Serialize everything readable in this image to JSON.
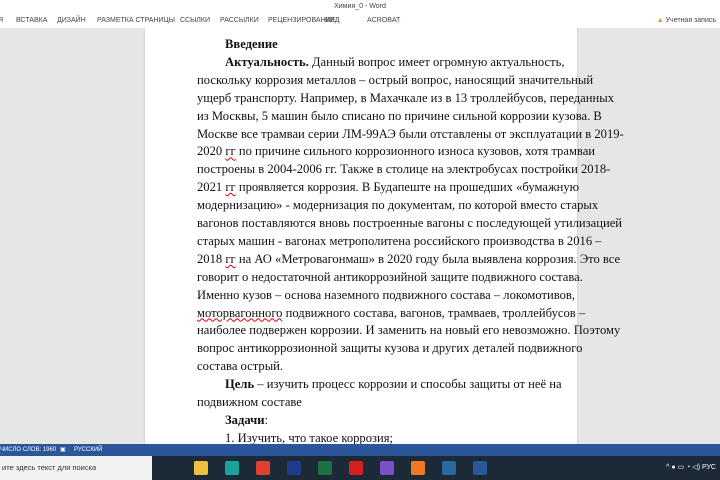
{
  "window": {
    "title": "Химия_0 - Word",
    "account": "Учетная запись"
  },
  "ribbon": {
    "tabs": [
      "Я",
      "ВСТАВКА",
      "ДИЗАЙН",
      "РАЗМЕТКА СТРАНИЦЫ",
      "ССЫЛКИ",
      "РАССЫЛКИ",
      "РЕЦЕНЗИРОВАНИЕ",
      "ВИД",
      "ACROBAT"
    ]
  },
  "document": {
    "lines": [
      {
        "ind": true,
        "last": true,
        "segs": [
          {
            "t": "Введение",
            "b": true
          }
        ]
      },
      {
        "ind": true,
        "segs": [
          {
            "t": "Актуальность.",
            "b": true
          },
          {
            "t": " Данный вопрос имеет огромную актуальность,"
          }
        ]
      },
      {
        "segs": [
          {
            "t": "поскольку коррозия металлов – острый вопрос, наносящий значительный"
          }
        ]
      },
      {
        "segs": [
          {
            "t": "ущерб транспорту. Например, в Махачкале из в 13 троллейбусов, переданных"
          }
        ]
      },
      {
        "segs": [
          {
            "t": "из Москвы, 5 машин было списано по причине сильной коррозии кузова. В"
          }
        ]
      },
      {
        "segs": [
          {
            "t": "Москве все трамваи серии ЛМ-99АЭ были отставлены от эксплуатации в 2019-"
          }
        ]
      },
      {
        "segs": [
          {
            "t": "2020 "
          },
          {
            "t": "гг",
            "e": true
          },
          {
            "t": " по причине сильного коррозионного износа кузовов, хотя трамваи"
          }
        ]
      },
      {
        "segs": [
          {
            "t": "построены в 2004-2006 гг. Также в столице на электробусах постройки 2018-"
          }
        ]
      },
      {
        "segs": [
          {
            "t": "2021 "
          },
          {
            "t": "гг",
            "e": true
          },
          {
            "t": " проявляется коррозия. В Будапеште на прошедших «бумажную"
          }
        ]
      },
      {
        "segs": [
          {
            "t": "модернизацию» - модернизация по документам, по которой вместо старых"
          }
        ]
      },
      {
        "segs": [
          {
            "t": "вагонов поставляются вновь построенные вагоны с последующей утилизацией"
          }
        ]
      },
      {
        "segs": [
          {
            "t": "старых машин - вагонах метрополитена российского производства в 2016 –"
          }
        ]
      },
      {
        "segs": [
          {
            "t": "2018 "
          },
          {
            "t": "гг",
            "e": true
          },
          {
            "t": " на АО «Метровагонмаш» в 2020 году была выявлена коррозия. Это все"
          }
        ]
      },
      {
        "segs": [
          {
            "t": "говорит о недостаточной антикоррозийной защите подвижного состава."
          }
        ]
      },
      {
        "segs": [
          {
            "t": "Именно кузов – основа наземного подвижного состава – локомотивов,"
          }
        ]
      },
      {
        "segs": [
          {
            "t": "моторвагонного",
            "e": true
          },
          {
            "t": " подвижного состава, вагонов, трамваев, троллейбусов –"
          }
        ]
      },
      {
        "segs": [
          {
            "t": "наиболее подвержен коррозии. И заменить на новый его невозможно. Поэтому"
          }
        ]
      },
      {
        "segs": [
          {
            "t": "вопрос антикоррозионной защиты кузова и других деталей подвижного"
          }
        ]
      },
      {
        "last": true,
        "segs": [
          {
            "t": "состава острый."
          }
        ]
      },
      {
        "ind": true,
        "segs": [
          {
            "t": "Цель",
            "b": true
          },
          {
            "t": " – изучить процесс коррозии и способы защиты от неё на"
          }
        ]
      },
      {
        "last": true,
        "segs": [
          {
            "t": "подвижном составе"
          }
        ]
      },
      {
        "ind": true,
        "last": true,
        "segs": [
          {
            "t": "Задачи",
            "b": true
          },
          {
            "t": ":"
          }
        ]
      },
      {
        "ind": true,
        "last": true,
        "segs": [
          {
            "t": "1.  Изучить, что такое коррозия;"
          }
        ]
      }
    ]
  },
  "status": {
    "words": "ЧИСЛО СЛОВ: 1960",
    "lang": "РУССКИЙ"
  },
  "taskbar": {
    "search": "ите здесь текст для поиска",
    "lang": "РУС",
    "apps": [
      {
        "name": "task-view",
        "color": "#1c2a38"
      },
      {
        "name": "file-explorer",
        "color": "#f0c040"
      },
      {
        "name": "app-teal",
        "color": "#1aa39a"
      },
      {
        "name": "chrome",
        "color": "#e04030"
      },
      {
        "name": "photoshop",
        "color": "#1f3c88"
      },
      {
        "name": "excel",
        "color": "#1e7145"
      },
      {
        "name": "acrobat",
        "color": "#d42020"
      },
      {
        "name": "app-purple",
        "color": "#7a4fc8"
      },
      {
        "name": "app-orange",
        "color": "#f07820"
      },
      {
        "name": "app-globe",
        "color": "#2a6a9a"
      },
      {
        "name": "word",
        "color": "#2b579a"
      }
    ]
  }
}
